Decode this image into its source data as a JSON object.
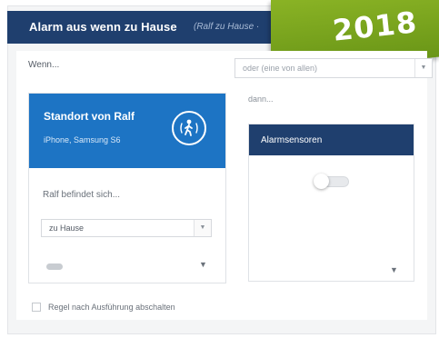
{
  "header": {
    "title": "Alarm aus wenn zu Hause",
    "subtitle": "(Ralf zu Hause ·"
  },
  "badge": {
    "year": "2018"
  },
  "condition": {
    "wenn_label": "Wenn...",
    "combine_select_value": "oder (eine von allen)",
    "dann_label": "dann..."
  },
  "location_card": {
    "title": "Standort von Ralf",
    "devices": "iPhone, Samsung S6",
    "icon": "person-walking-icon",
    "prompt": "Ralf befindet sich...",
    "select_value": "zu Hause"
  },
  "alarm_card": {
    "title": "Alarmsensoren",
    "toggle_on": false
  },
  "footer": {
    "checkbox_label": "Regel nach Ausführung abschalten"
  },
  "colors": {
    "header_bg": "#1f3f6e",
    "card_blue": "#1d74c4",
    "badge_green": "#7aa81f"
  }
}
